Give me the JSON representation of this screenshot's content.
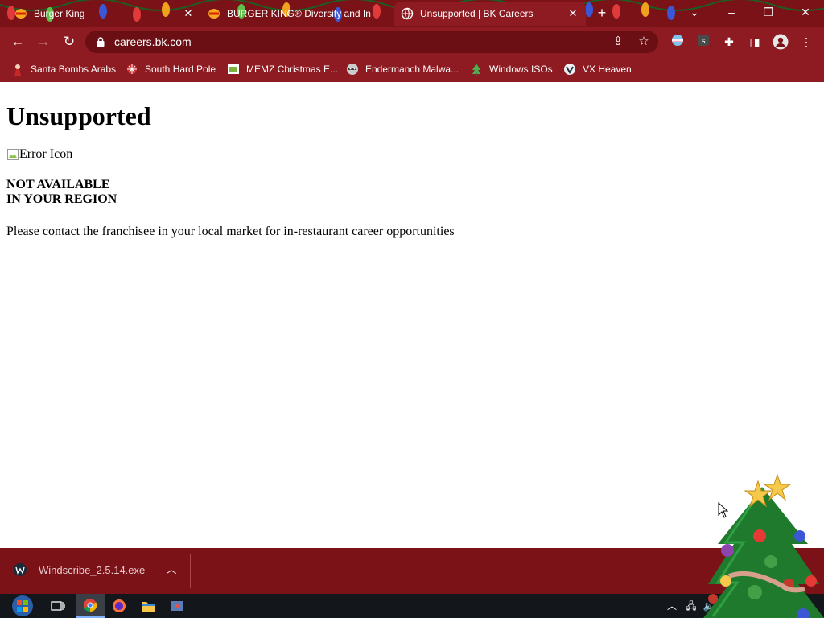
{
  "browser": {
    "tabs": [
      {
        "title": "Burger King",
        "favicon": "burger-king-logo-icon",
        "active": false
      },
      {
        "title": "BURGER KING® Diversity and In",
        "favicon": "burger-king-logo-icon",
        "active": false
      },
      {
        "title": "Unsupported | BK Careers",
        "favicon": "globe-icon",
        "active": true
      }
    ],
    "url": "careers.bk.com",
    "bookmarks": [
      {
        "label": "Santa Bombs Arabs",
        "icon": "santa-icon"
      },
      {
        "label": "South Hard Pole",
        "icon": "snowflake-icon"
      },
      {
        "label": "MEMZ Christmas E...",
        "icon": "memz-icon"
      },
      {
        "label": "Endermanch Malwa...",
        "icon": "raccoon-icon"
      },
      {
        "label": "Windows ISOs",
        "icon": "christmas-tree-icon"
      },
      {
        "label": "VX Heaven",
        "icon": "vx-heaven-icon"
      }
    ],
    "colors": {
      "frame": "#7a1217",
      "toolbar": "#8e1b21"
    }
  },
  "page": {
    "heading": "Unsupported",
    "image_alt": "Error Icon",
    "region_line1": "NOT AVAILABLE",
    "region_line2": "IN YOUR REGION",
    "message": "Please contact the franchisee in your local market for in-restaurant career opportunities"
  },
  "download_shelf": {
    "filename": "Windscribe_2.5.14.exe",
    "icon": "windscribe-icon"
  },
  "taskbar": {
    "items": [
      "start-orb-icon",
      "task-view-icon",
      "chrome-icon",
      "firefox-icon",
      "file-explorer-icon",
      "app-icon"
    ]
  }
}
